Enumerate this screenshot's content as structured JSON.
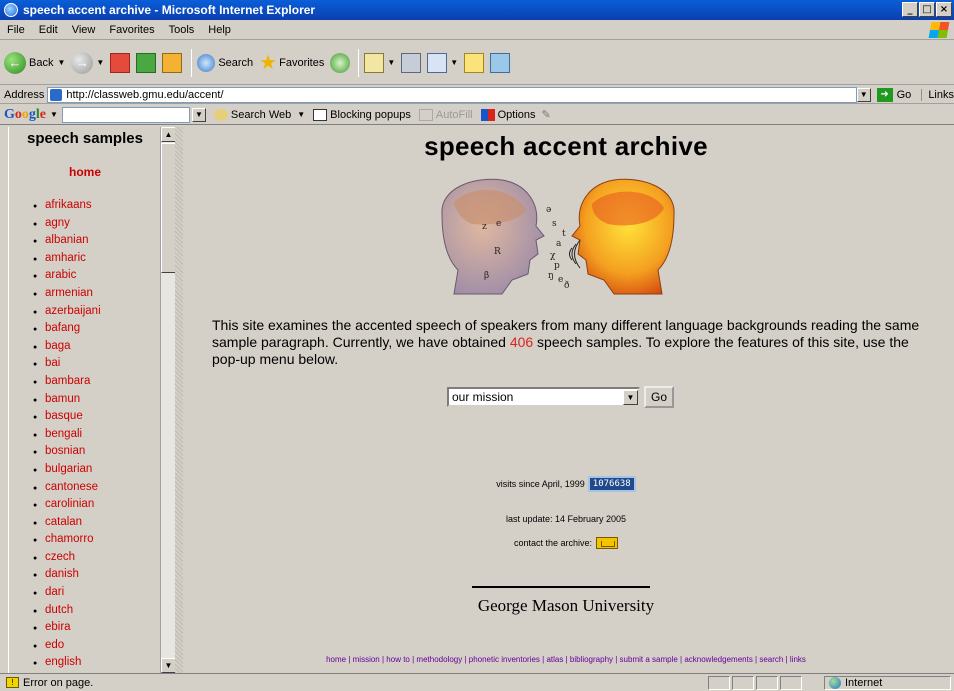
{
  "window": {
    "title": "speech accent archive - Microsoft Internet Explorer",
    "controls": [
      "_",
      "□",
      "×"
    ]
  },
  "menu": [
    "File",
    "Edit",
    "View",
    "Favorites",
    "Tools",
    "Help"
  ],
  "toolbar": {
    "back": "Back",
    "search": "Search",
    "favorites": "Favorites"
  },
  "address": {
    "label": "Address",
    "url": "http://classweb.gmu.edu/accent/",
    "go": "Go",
    "links": "Links"
  },
  "googlebar": {
    "logo": "Google",
    "search_web": "Search Web",
    "blocking": "Blocking popups",
    "autofill": "AutoFill",
    "options": "Options"
  },
  "sidebar": {
    "title": "speech samples",
    "home": "home",
    "items": [
      "afrikaans",
      "agny",
      "albanian",
      "amharic",
      "arabic",
      "armenian",
      "azerbaijani",
      "bafang",
      "baga",
      "bai",
      "bambara",
      "bamun",
      "basque",
      "bengali",
      "bosnian",
      "bulgarian",
      "cantonese",
      "carolinian",
      "catalan",
      "chamorro",
      "czech",
      "danish",
      "dari",
      "dutch",
      "ebira",
      "edo",
      "english"
    ]
  },
  "main": {
    "title": "speech accent archive",
    "intro_a": "This site examines the accented speech of speakers from many different language backgrounds reading the same sample paragraph. Currently, we have obtained ",
    "intro_count": "406",
    "intro_b": " speech samples. To explore the features of this site, use the pop-up menu below.",
    "select_value": "our mission",
    "go_label": "Go",
    "visits_label": "visits since April, 1999",
    "counter": "1076638",
    "updated": "last update: 14 February 2005",
    "contact": "contact the archive:",
    "university": "George Mason University",
    "footer_links": [
      "home",
      "mission",
      "how to",
      "methodology",
      "phonetic inventories",
      "atlas",
      "bibliography",
      "submit a sample",
      "acknowledgements",
      "search",
      "links"
    ]
  },
  "status": {
    "message": "Error on page.",
    "zone": "Internet"
  }
}
